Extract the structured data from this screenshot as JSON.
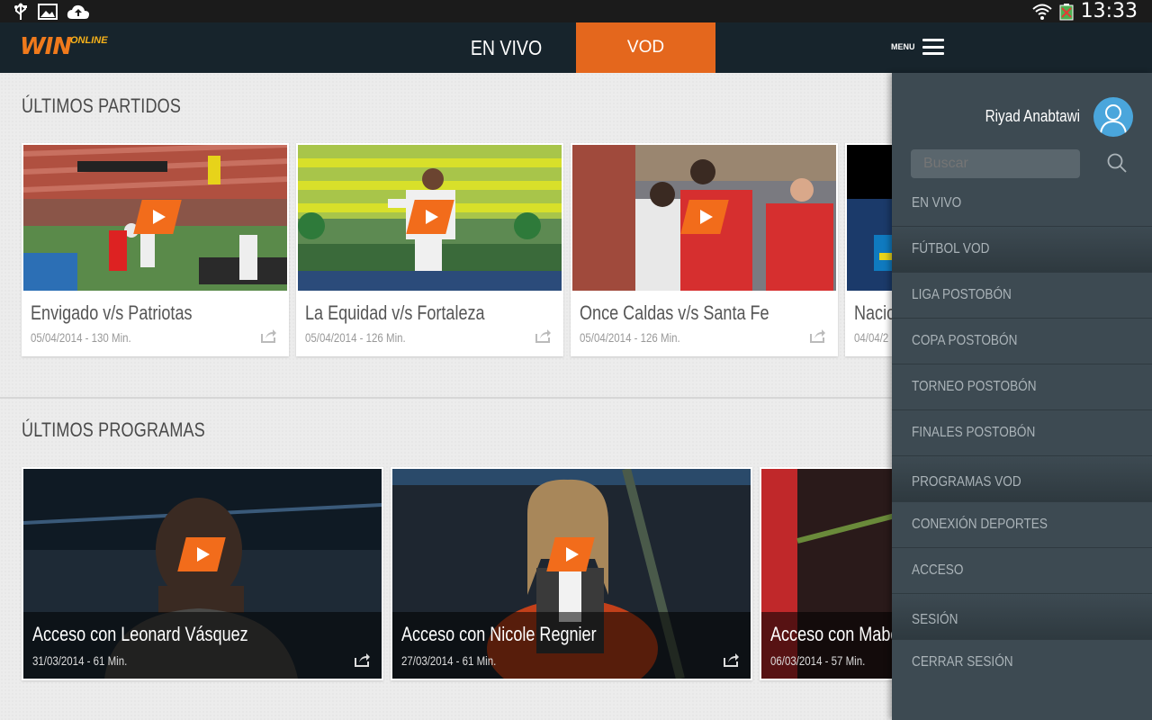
{
  "status_bar": {
    "time": "13:33"
  },
  "app_bar": {
    "logo_text": "WIN",
    "logo_sub": "ONLINE",
    "tabs": [
      {
        "label": "EN VIVO",
        "active": false
      },
      {
        "label": "VOD",
        "active": true
      }
    ],
    "menu_label": "MENU"
  },
  "sections": {
    "partidos": {
      "title": "ÚLTIMOS PARTIDOS",
      "items": [
        {
          "title": "Envigado v/s Patriotas",
          "meta": "05/04/2014 - 130 Min."
        },
        {
          "title": "La Equidad v/s Fortaleza",
          "meta": "05/04/2014 - 126 Min."
        },
        {
          "title": "Once Caldas v/s Santa Fe",
          "meta": "05/04/2014 - 126 Min."
        },
        {
          "title": "Nacio",
          "meta": "04/04/2"
        }
      ]
    },
    "programas": {
      "title": "ÚLTIMOS PROGRAMAS",
      "items": [
        {
          "title": "Acceso con Leonard Vásquez",
          "meta": "31/03/2014 - 61 Min."
        },
        {
          "title": "Acceso con Nicole Regnier",
          "meta": "27/03/2014 - 61 Min."
        },
        {
          "title": "Acceso con Mabel",
          "meta": "06/03/2014 - 57 Min."
        }
      ]
    }
  },
  "side_menu": {
    "user_name": "Riyad Anabtawi",
    "search_placeholder": "Buscar",
    "items": [
      {
        "label": "EN VIVO",
        "header": false
      },
      {
        "label": "FÚTBOL VOD",
        "header": true
      },
      {
        "label": "LIGA POSTOBÓN",
        "header": false
      },
      {
        "label": "COPA POSTOBÓN",
        "header": false
      },
      {
        "label": "TORNEO POSTOBÓN",
        "header": false
      },
      {
        "label": "FINALES POSTOBÓN",
        "header": false
      },
      {
        "label": "PROGRAMAS VOD",
        "header": true
      },
      {
        "label": "CONEXIÓN DEPORTES",
        "header": false
      },
      {
        "label": "ACCESO",
        "header": false
      },
      {
        "label": "SESIÓN",
        "header": true
      },
      {
        "label": "CERRAR SESIÓN",
        "header": false
      }
    ]
  },
  "colors": {
    "accent": "#e4671d",
    "app_bar": "#17242c",
    "side_menu": "#3d4a52"
  },
  "icons": [
    "usb-icon",
    "image-icon",
    "cloud-upload-icon",
    "wifi-icon",
    "battery-icon",
    "menu-icon",
    "play-icon",
    "share-icon",
    "search-icon",
    "avatar-icon"
  ]
}
